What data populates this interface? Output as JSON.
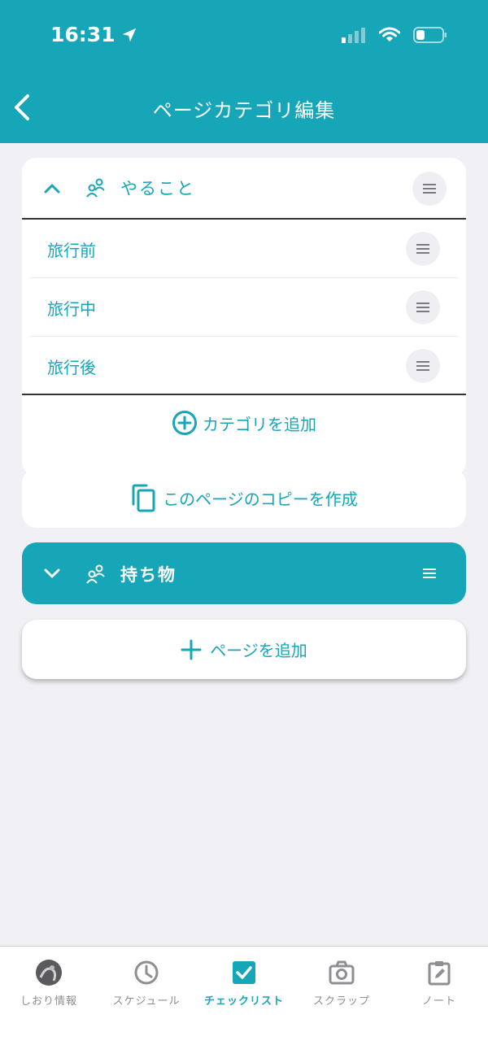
{
  "status": {
    "time": "16:31"
  },
  "nav": {
    "title": "ページカテゴリ編集"
  },
  "section1": {
    "title": "やること",
    "items": [
      {
        "label": "旅行前"
      },
      {
        "label": "旅行中"
      },
      {
        "label": "旅行後"
      }
    ],
    "add_category": "カテゴリを追加"
  },
  "copy_page": "このページのコピーを作成",
  "section2": {
    "title": "持ち物"
  },
  "add_page": "ページを追加",
  "tabs": [
    {
      "label": "しおり情報"
    },
    {
      "label": "スケジュール"
    },
    {
      "label": "チェックリスト"
    },
    {
      "label": "スクラップ"
    },
    {
      "label": "ノート"
    }
  ],
  "colors": {
    "accent": "#17a5b8",
    "background": "#f0f0f5"
  }
}
